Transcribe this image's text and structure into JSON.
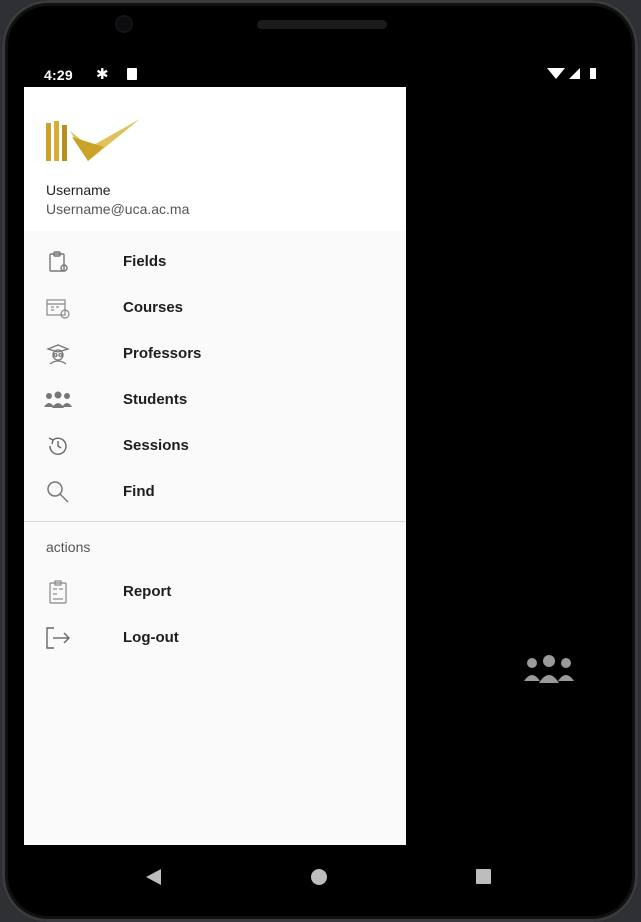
{
  "status_bar": {
    "time": "4:29"
  },
  "drawer": {
    "header": {
      "username": "Username",
      "email": "Username@uca.ac.ma"
    },
    "items": [
      {
        "label": "Fields",
        "icon": "clipboard-icon"
      },
      {
        "label": "Courses",
        "icon": "calendar-clock-icon"
      },
      {
        "label": "Professors",
        "icon": "professor-icon"
      },
      {
        "label": "Students",
        "icon": "students-group-icon"
      },
      {
        "label": "Sessions",
        "icon": "history-clock-icon"
      },
      {
        "label": "Find",
        "icon": "search-icon"
      }
    ],
    "section_label": "actions",
    "actions": [
      {
        "label": "Report",
        "icon": "report-icon"
      },
      {
        "label": "Log-out",
        "icon": "logout-icon"
      }
    ]
  },
  "colors": {
    "logo_gold": "#c9a227",
    "drawer_bg": "#fafafa",
    "backdrop": "#000000"
  }
}
